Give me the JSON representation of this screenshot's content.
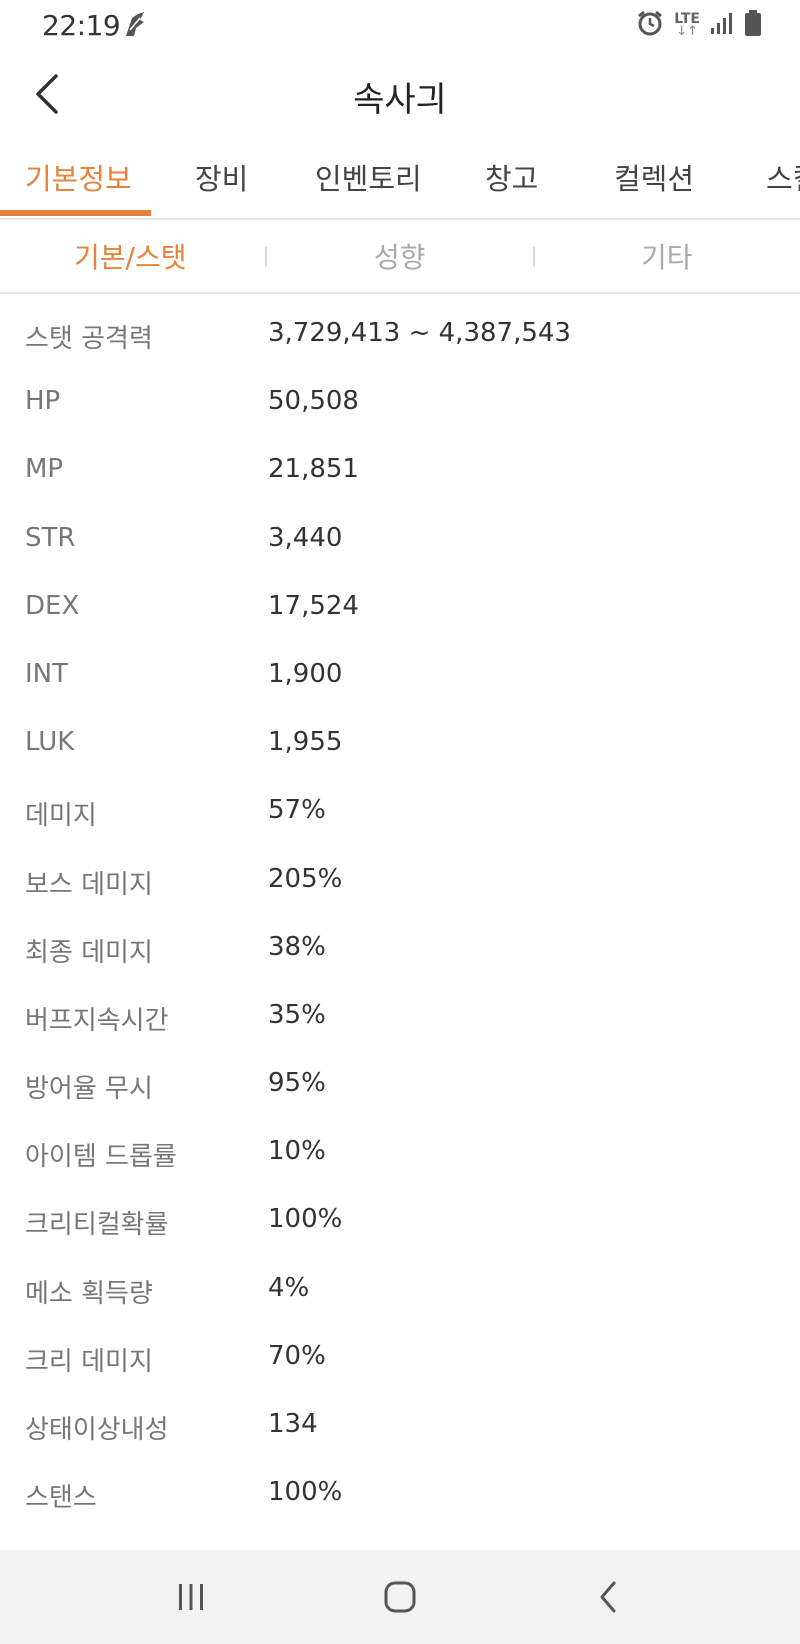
{
  "status_bar": {
    "time": "22:19",
    "left_icon": "notification-icon",
    "right_icons": [
      "alarm-icon",
      "lte-icon",
      "signal-icon",
      "battery-icon"
    ],
    "lte_label": "LTE"
  },
  "header": {
    "title": "속사긔",
    "back_icon": "chevron-left-icon"
  },
  "main_tabs": [
    {
      "label": "기본정보",
      "active": true
    },
    {
      "label": "장비",
      "active": false
    },
    {
      "label": "인벤토리",
      "active": false
    },
    {
      "label": "창고",
      "active": false
    },
    {
      "label": "컬렉션",
      "active": false
    },
    {
      "label": "스킬",
      "active": false
    }
  ],
  "sub_tabs": [
    {
      "label": "기본/스탯",
      "active": true
    },
    {
      "label": "성향",
      "active": false
    },
    {
      "label": "기타",
      "active": false
    }
  ],
  "stats": [
    {
      "label": "스탯 공격력",
      "value": "3,729,413 ~ 4,387,543"
    },
    {
      "label": "HP",
      "value": "50,508"
    },
    {
      "label": "MP",
      "value": "21,851"
    },
    {
      "label": "STR",
      "value": "3,440"
    },
    {
      "label": "DEX",
      "value": "17,524"
    },
    {
      "label": "INT",
      "value": "1,900"
    },
    {
      "label": "LUK",
      "value": "1,955"
    },
    {
      "label": "데미지",
      "value": "57%"
    },
    {
      "label": "보스 데미지",
      "value": "205%"
    },
    {
      "label": "최종 데미지",
      "value": "38%"
    },
    {
      "label": "버프지속시간",
      "value": "35%"
    },
    {
      "label": "방어율 무시",
      "value": "95%"
    },
    {
      "label": "아이템 드롭률",
      "value": "10%"
    },
    {
      "label": "크리티컬확률",
      "value": "100%"
    },
    {
      "label": "메소 획득량",
      "value": "4%"
    },
    {
      "label": "크리 데미지",
      "value": "70%"
    },
    {
      "label": "상태이상내성",
      "value": "134"
    },
    {
      "label": "스탠스",
      "value": "100%"
    }
  ],
  "nav_bar": {
    "items": [
      "recent-apps-icon",
      "home-icon",
      "back-icon"
    ]
  },
  "colors": {
    "accent": "#e8823a",
    "text_primary": "#333333",
    "text_secondary": "#777777",
    "nav_background": "#f2f2f2"
  }
}
